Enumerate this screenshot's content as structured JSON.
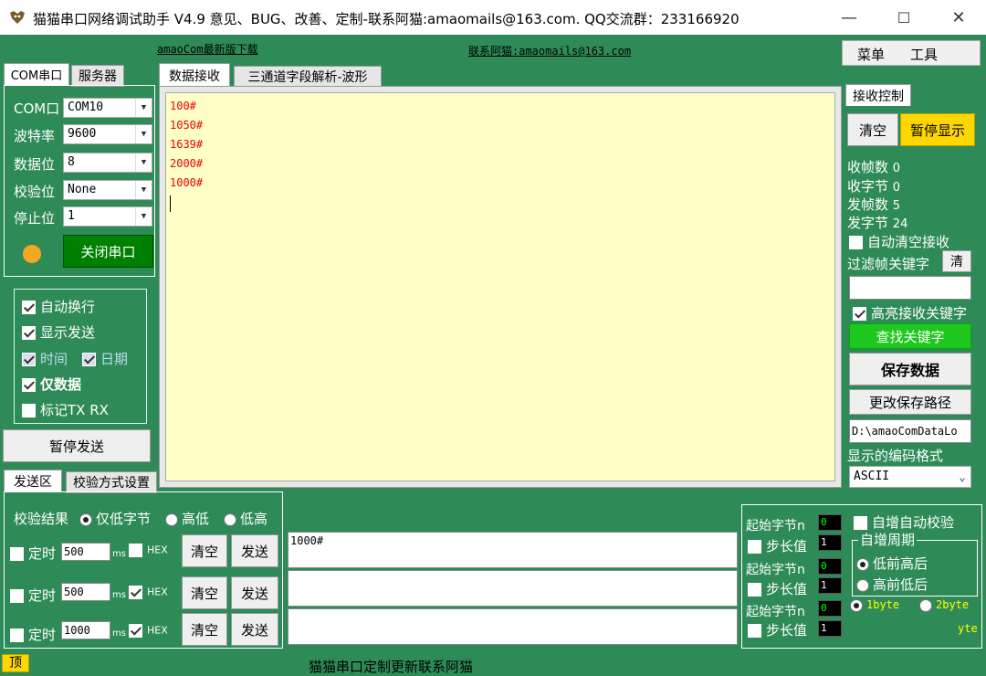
{
  "window": {
    "title": "猫猫串口网络调试助手 V4.9 意见、BUG、改善、定制-联系阿猫:amaomails@163.com. QQ交流群：233166920",
    "minimize": "—",
    "maximize": "☐",
    "close": "✕"
  },
  "top_links": {
    "download": "amaoCom最新版下载",
    "contact": "联系阿猫:amaomails@163.com"
  },
  "menu": {
    "menu": "菜单",
    "tools": "工具"
  },
  "left_tabs": [
    "COM串口",
    "服务器"
  ],
  "port_settings": {
    "rows": [
      {
        "label": "COM口",
        "value": "COM10"
      },
      {
        "label": "波特率",
        "value": "9600"
      },
      {
        "label": "数据位",
        "value": "8"
      },
      {
        "label": "校验位",
        "value": "None"
      },
      {
        "label": "停止位",
        "value": "1"
      }
    ],
    "status_color": "#f5a623",
    "close_button": "关闭串口"
  },
  "display_options": {
    "auto_wrap": "自动换行",
    "show_send": "显示发送",
    "time": "时间",
    "date": "日期",
    "data_only": "仅数据",
    "mark_txrx": "标记TX RX",
    "pause_send": "暂停发送"
  },
  "center_tabs": [
    "数据接收",
    "三通道字段解析-波形"
  ],
  "receive_lines": [
    "100#",
    "1050#",
    "1639#",
    "2000#",
    "1000#"
  ],
  "receive_control": {
    "tab": "接收控制",
    "clear": "清空",
    "pause_display": "暂停显示",
    "stats": [
      {
        "label": "收帧数",
        "value": "0"
      },
      {
        "label": "收字节",
        "value": "0"
      },
      {
        "label": "发帧数",
        "value": "5"
      },
      {
        "label": "发字节",
        "value": "24"
      }
    ],
    "auto_clear": "自动清空接收",
    "filter_label": "过滤帧关键字",
    "filter_clear": "清",
    "filter_value": "",
    "highlight": "高亮接收关键字",
    "find_keyword": "查找关键字",
    "save_data": "保存数据",
    "change_path": "更改保存路径",
    "path": "D:\\amaoComDataLo",
    "encoding_label": "显示的编码格式",
    "encoding": "ASCII"
  },
  "send_tabs": [
    "发送区",
    "校验方式设置"
  ],
  "send_area": {
    "check_result": "校验结果",
    "opts": [
      "仅低字节",
      "高低",
      "低高"
    ],
    "timer": "定时",
    "ms": "ms",
    "hex": "HEX",
    "clear": "清空",
    "send": "发送",
    "rows": [
      {
        "interval": "500",
        "hex": false,
        "content": "1000#"
      },
      {
        "interval": "500",
        "hex": true,
        "content": ""
      },
      {
        "interval": "1000",
        "hex": true,
        "content": ""
      }
    ]
  },
  "increment": {
    "start_label": "起始字节n",
    "step_label": "步长值",
    "rows": [
      {
        "start": "0",
        "step": "1"
      },
      {
        "start": "0",
        "step": "1"
      },
      {
        "start": "0",
        "step": "1"
      }
    ],
    "auto_check": "自增自动校验",
    "period": "自增周期",
    "low_first": "低前高后",
    "high_first": "高前低后",
    "byte1": "1byte",
    "byte2": "2byte",
    "byte_tail": "yte"
  },
  "footer": {
    "top": "顶",
    "text": "猫猫串口定制更新联系阿猫"
  }
}
